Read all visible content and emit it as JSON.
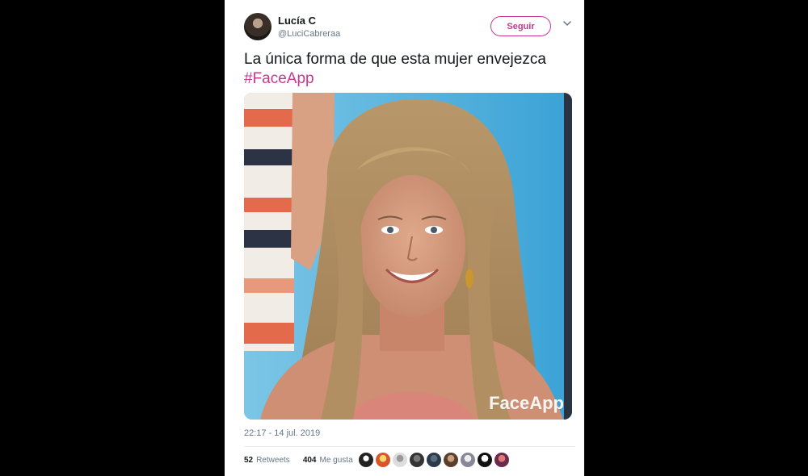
{
  "tweet": {
    "author_name": "Lucía C",
    "author_handle": "@LuciCabreraa",
    "follow_label": "Seguir",
    "text": "La única forma de que esta mujer envejezca",
    "hashtag": "#FaceApp",
    "image_watermark": "FaceApp",
    "timestamp": "22:17 - 14 jul. 2019",
    "retweets_count": "52",
    "retweets_label": "Retweets",
    "likes_count": "404",
    "likes_label": "Me gusta"
  },
  "colors": {
    "accent": "#c9388f",
    "background": "#000000",
    "card": "#ffffff",
    "muted_text": "#657786"
  },
  "icons": [
    "chevron-down-icon",
    "avatar"
  ]
}
